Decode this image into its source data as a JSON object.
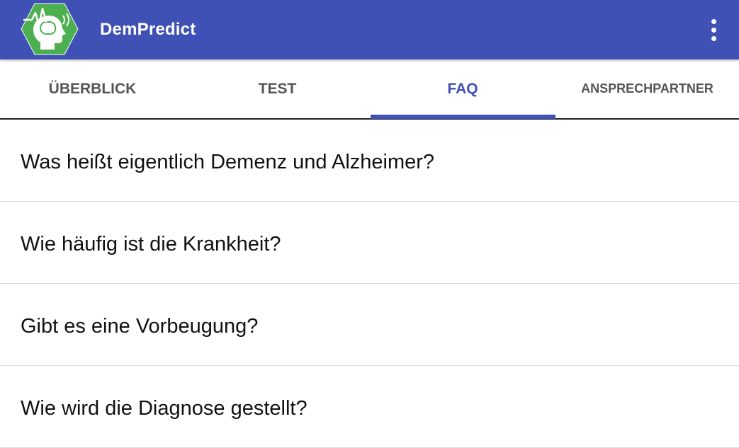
{
  "app_bar": {
    "title": "DemPredict",
    "brand_color": "#3f51b5",
    "logo_color": "#4caf50",
    "logo_icon": "head-signal-icon",
    "menu_icon": "overflow-menu-icon"
  },
  "tabs": [
    {
      "label": "ÜBERBLICK",
      "selected": false
    },
    {
      "label": "TEST",
      "selected": false
    },
    {
      "label": "FAQ",
      "selected": true
    },
    {
      "label": "ANSPRECHPARTNER",
      "selected": false
    }
  ],
  "faq": {
    "items": [
      "Was heißt eigentlich Demenz und Alzheimer?",
      "Wie häufig ist die Krankheit?",
      "Gibt es eine Vorbeugung?",
      "Wie wird die Diagnose gestellt?"
    ]
  }
}
